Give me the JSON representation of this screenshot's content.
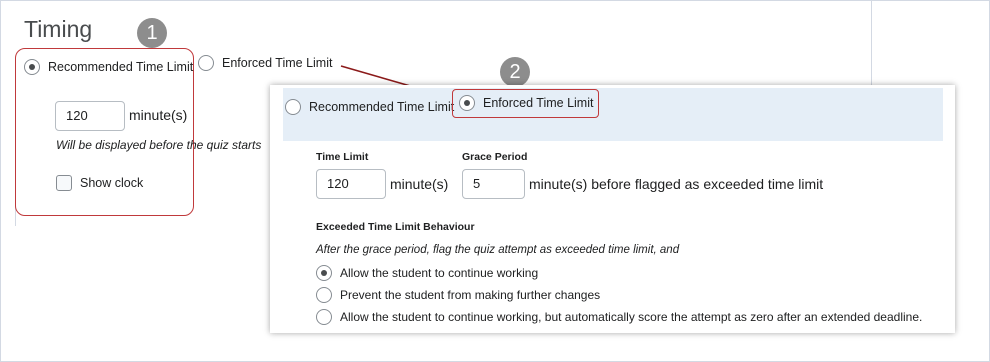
{
  "left": {
    "title": "Timing",
    "radio_recommended": "Recommended Time Limit",
    "radio_enforced": "Enforced Time Limit",
    "minutes_value": "120",
    "minutes_unit": "minute(s)",
    "hint": "Will be displayed before the quiz starts",
    "show_clock": "Show clock"
  },
  "badges": {
    "one": "1",
    "two": "2"
  },
  "panel": {
    "radio_recommended": "Recommended Time Limit",
    "radio_enforced": "Enforced Time Limit",
    "time_limit_label": "Time Limit",
    "time_limit_value": "120",
    "time_limit_unit": "minute(s)",
    "grace_label": "Grace Period",
    "grace_value": "5",
    "grace_unit": "minute(s) before flagged as exceeded time limit",
    "behaviour_title": "Exceeded Time Limit Behaviour",
    "behaviour_desc": "After the grace period, flag the quiz attempt as exceeded time limit, and",
    "options": [
      "Allow the student to continue working",
      "Prevent the student from making further changes",
      "Allow the student to continue working, but automatically score the attempt as zero after an extended deadline."
    ]
  },
  "colors": {
    "highlight": "#c0393b",
    "badge": "#8d8d8d",
    "selected_bg": "#e5eef7"
  }
}
